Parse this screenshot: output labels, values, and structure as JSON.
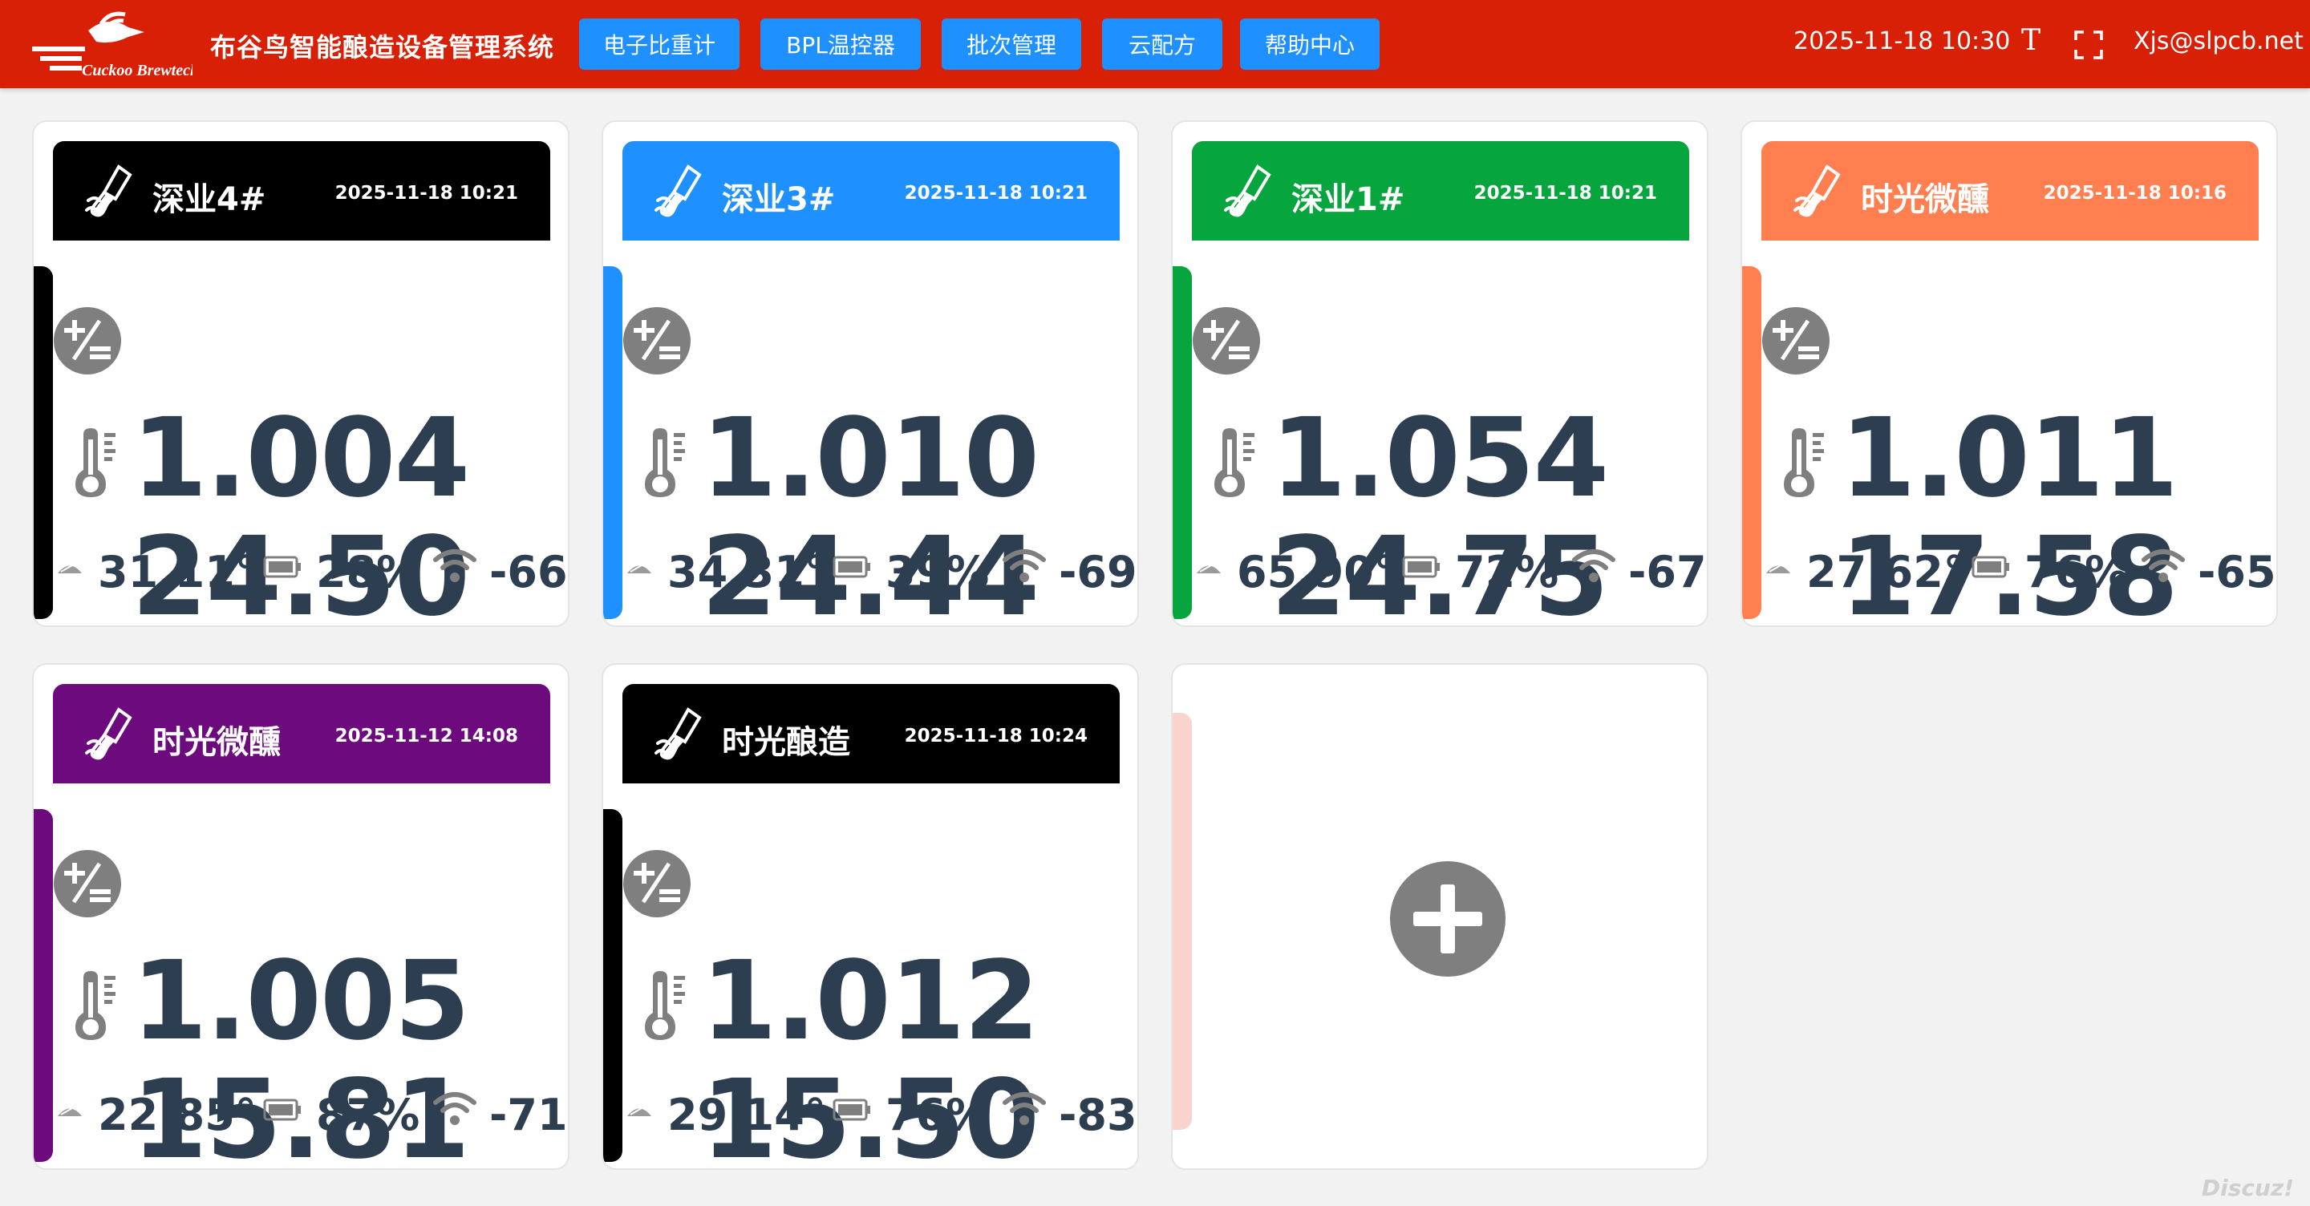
{
  "header": {
    "logo_text": "Cuckoo Brewtech",
    "system_title": "布谷鸟智能酿造设备管理系统",
    "nav": [
      {
        "label": "电子比重计"
      },
      {
        "label": "BPL温控器"
      },
      {
        "label": "批次管理"
      },
      {
        "label": "云配方"
      },
      {
        "label": "帮助中心"
      }
    ],
    "datetime": "2025-11-18 10:30",
    "font_icon_glyph": "T",
    "user_email": "Xjs@slpcb.net"
  },
  "devices": [
    {
      "name": "深业4#",
      "time": "2025-11-18 10:21",
      "gravity": "1.004",
      "temperature": "24.50",
      "angle": "31.11°",
      "battery": "28%",
      "rssi": "-66",
      "color": "#000000"
    },
    {
      "name": "深业3#",
      "time": "2025-11-18 10:21",
      "gravity": "1.010",
      "temperature": "24.44",
      "angle": "34.31°",
      "battery": "39%",
      "rssi": "-69",
      "color": "#1e90ff"
    },
    {
      "name": "深业1#",
      "time": "2025-11-18 10:21",
      "gravity": "1.054",
      "temperature": "24.75",
      "angle": "65.90°",
      "battery": "72%",
      "rssi": "-67",
      "color": "#07a53d"
    },
    {
      "name": "时光微醺",
      "time": "2025-11-18 10:16",
      "gravity": "1.011",
      "temperature": "17.58",
      "angle": "27.62°",
      "battery": "76%",
      "rssi": "-65",
      "color": "#ff7f50"
    },
    {
      "name": "时光微醺",
      "time": "2025-11-12 14:08",
      "gravity": "1.005",
      "temperature": "15.81",
      "angle": "22.85°",
      "battery": "87%",
      "rssi": "-71",
      "color": "#6c0a7e"
    },
    {
      "name": "时光酿造",
      "time": "2025-11-18 10:24",
      "gravity": "1.012",
      "temperature": "15.50",
      "angle": "29.14°",
      "battery": "76%",
      "rssi": "-83",
      "color": "#000000"
    }
  ],
  "watermark": "Discuz!"
}
